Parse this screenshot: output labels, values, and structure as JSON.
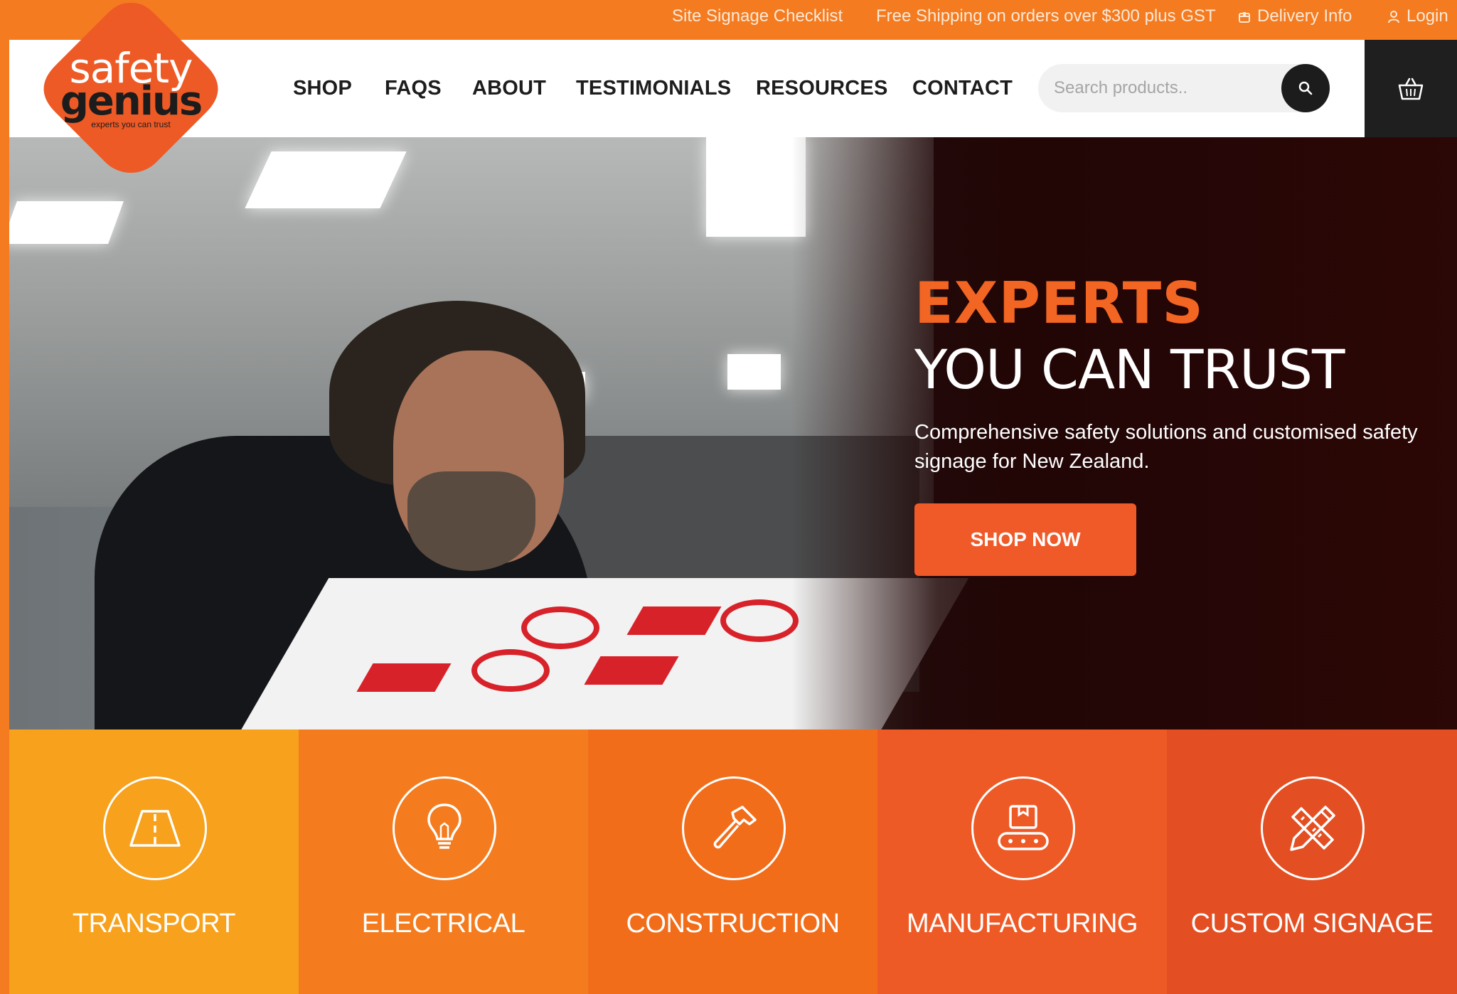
{
  "topbar": {
    "checklist": "Site Signage Checklist",
    "shipping": "Free Shipping on orders over $300 plus GST",
    "delivery": "Delivery Info",
    "login": "Login"
  },
  "logo": {
    "line1": "safety",
    "line2": "genius",
    "tagline": "experts you can trust"
  },
  "nav": {
    "items": [
      "SHOP",
      "FAQS",
      "ABOUT",
      "TESTIMONIALS",
      "RESOURCES",
      "CONTACT"
    ]
  },
  "search": {
    "placeholder": "Search products.."
  },
  "hero": {
    "headline_1": "EXPERTS",
    "headline_2": "YOU CAN TRUST",
    "description": "Comprehensive safety solutions and customised safety signage for New Zealand.",
    "cta": "SHOP NOW"
  },
  "categories": [
    {
      "label": "TRANSPORT",
      "icon": "road-icon",
      "color": "#f7a11c"
    },
    {
      "label": "ELECTRICAL",
      "icon": "lightbulb-icon",
      "color": "#f47c1e"
    },
    {
      "label": "CONSTRUCTION",
      "icon": "hammer-icon",
      "color": "#f26d1a"
    },
    {
      "label": "MANUFACTURING",
      "icon": "conveyor-icon",
      "color": "#ee5a26"
    },
    {
      "label": "CUSTOM SIGNAGE",
      "icon": "pencil-ruler-icon",
      "color": "#e34f23"
    }
  ],
  "colors": {
    "brand_orange": "#f47b20",
    "cta": "#f05a28",
    "dark": "#1c1c1c"
  }
}
